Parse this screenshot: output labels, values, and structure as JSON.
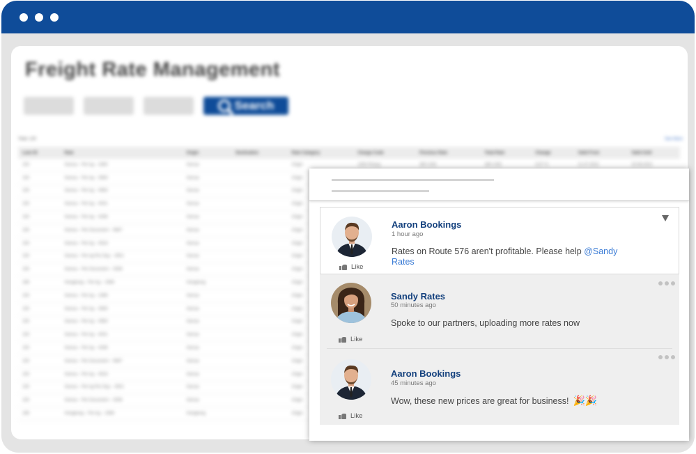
{
  "app": {
    "title": "Freight Rate Management",
    "search_label": "Search",
    "total_label": "Total: 120",
    "see_all": "See More",
    "colors": {
      "brand": "#0f4c99",
      "link": "#3a7bd5"
    }
  },
  "table": {
    "columns": [
      "Lane ID",
      "Rate",
      "Origin",
      "Destination",
      "Rate Category",
      "Charge Code",
      "Previous Rate",
      "Total Rate",
      "Change",
      "Valid From",
      "Valid Until"
    ],
    "rows": [
      [
        "153",
        "Genoa – Per kg – 1650",
        "Genoa",
        "",
        "Origin",
        "1000 Pickup",
        "350 USD",
        "380 USD",
        "8.57 %",
        "21.07.2022",
        "20.08.2022"
      ],
      [
        "153",
        "Genoa – Per kg – 3563",
        "Genoa",
        "",
        "Origin"
      ],
      [
        "153",
        "Genoa – Per kg – 4563",
        "Genoa",
        "",
        "Origin"
      ],
      [
        "153",
        "Genoa – Per kg – 4041",
        "Genoa",
        "",
        "Origin"
      ],
      [
        "153",
        "Genoa – Per kg – 4336",
        "Genoa",
        "",
        "Origin"
      ],
      [
        "153",
        "Genoa – Per Document – 5667",
        "Genoa",
        "",
        "Origin"
      ],
      [
        "153",
        "Genoa – Per kg – 4518",
        "Genoa",
        "",
        "Origin"
      ],
      [
        "153",
        "Genoa – Per kg Per Day – 4501",
        "Genoa",
        "",
        "Origin"
      ],
      [
        "153",
        "Genoa – Per Document – 3336",
        "Genoa",
        "",
        "Origin"
      ],
      [
        "166",
        "Hongkong – Per kg – 1566",
        "Hongkong",
        "",
        "Origin"
      ],
      [
        "153",
        "Genoa – Per kg – 1566",
        "Genoa",
        "",
        "Origin"
      ],
      [
        "153",
        "Genoa – Per kg – 3563",
        "Genoa",
        "",
        "Origin"
      ],
      [
        "153",
        "Genoa – Per kg – 4563",
        "Genoa",
        "",
        "Origin"
      ],
      [
        "153",
        "Genoa – Per kg – 4041",
        "Genoa",
        "",
        "Origin"
      ],
      [
        "153",
        "Genoa – Per kg – 4336",
        "Genoa",
        "",
        "Origin"
      ],
      [
        "153",
        "Genoa – Per Document – 5667",
        "Genoa",
        "",
        "Origin"
      ],
      [
        "153",
        "Genoa – Per kg – 4518",
        "Genoa",
        "",
        "Origin"
      ],
      [
        "153",
        "Genoa – Per kg Per Day – 4501",
        "Genoa",
        "",
        "Origin"
      ],
      [
        "153",
        "Genoa – Per Document – 3336",
        "Genoa",
        "",
        "Origin"
      ],
      [
        "166",
        "Hongkong – Per kg – 1566",
        "Hongkong",
        "",
        "Origin"
      ]
    ]
  },
  "comments": [
    {
      "author": "Aaron Bookings",
      "time": "1 hour ago",
      "text": "Rates on Route 576 aren't profitable. Please help ",
      "mention": "@Sandy Rates",
      "like": "Like",
      "avatar": "man",
      "emoji": ""
    },
    {
      "author": "Sandy Rates",
      "time": "50 minutes ago",
      "text": "Spoke to our partners, uploading more rates now",
      "mention": "",
      "like": "Like",
      "avatar": "woman",
      "emoji": ""
    },
    {
      "author": "Aaron Bookings",
      "time": "45 minutes ago",
      "text": "Wow, these new prices are great for business!",
      "mention": "",
      "like": "Like",
      "avatar": "man",
      "emoji": "🎉🎉"
    }
  ]
}
